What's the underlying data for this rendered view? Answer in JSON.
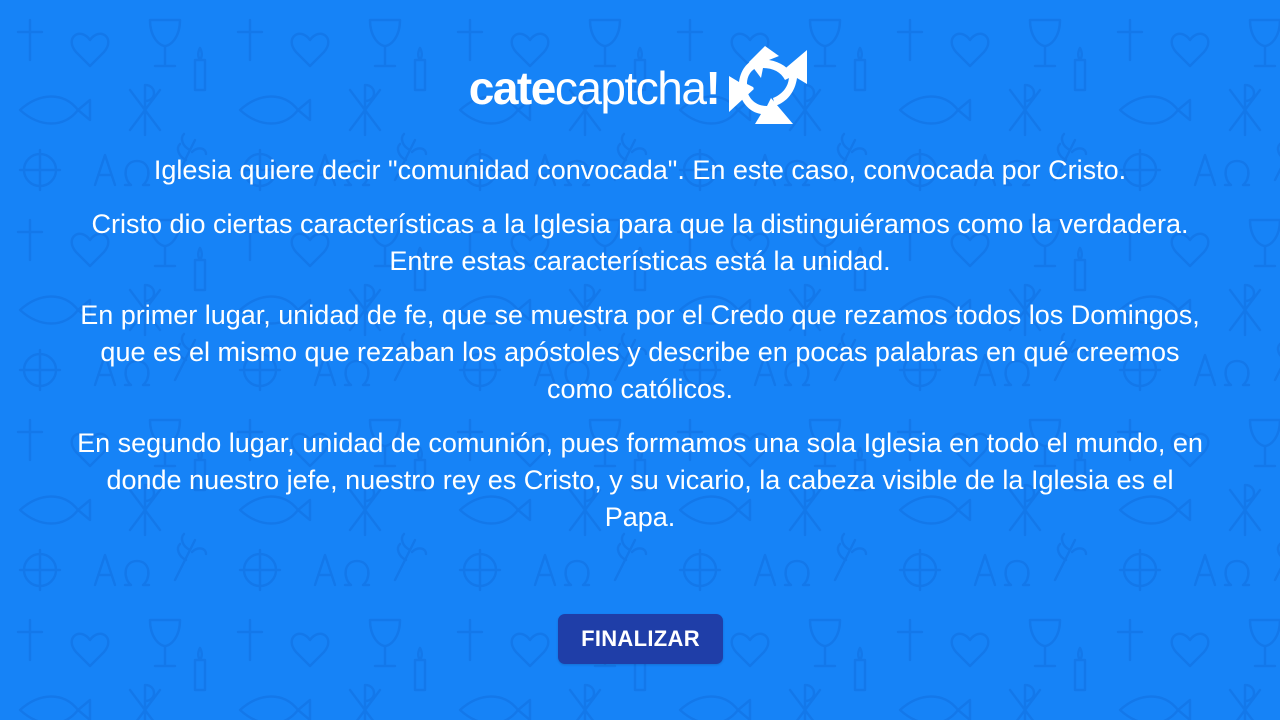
{
  "logo": {
    "bold_part": "cate",
    "light_part": "captcha",
    "exclamation": "!",
    "icon": "refresh-arrows-icon"
  },
  "paragraphs": [
    "Iglesia quiere decir \"comunidad convocada\". En este caso, convocada por Cristo.",
    "Cristo dio ciertas características a la Iglesia para que la distinguiéramos como la verdadera. Entre estas características está la unidad.",
    "En primer lugar, unidad de fe, que se muestra por el Credo que rezamos todos los Domingos, que es el mismo que rezaban los apóstoles y describe en pocas palabras en qué creemos como católicos.",
    "En segundo lugar, unidad de comunión, pues formamos una sola Iglesia en todo el mundo, en donde nuestro jefe, nuestro rey es Cristo, y su vicario, la cabeza visible de la Iglesia es el Papa."
  ],
  "button": {
    "label": "FINALIZAR"
  },
  "colors": {
    "background": "#1683f7",
    "button": "#1f3ea8",
    "text": "#ffffff"
  }
}
